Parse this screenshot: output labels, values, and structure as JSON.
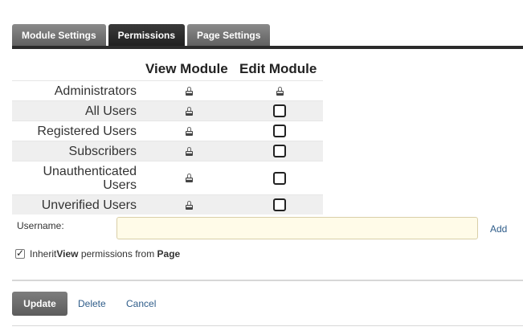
{
  "tabs": [
    {
      "label": "Module Settings",
      "active": false
    },
    {
      "label": "Permissions",
      "active": true
    },
    {
      "label": "Page Settings",
      "active": false
    }
  ],
  "columns": {
    "view": "View Module",
    "edit": "Edit Module"
  },
  "roles": [
    {
      "label": "Administrators",
      "view": "lock-icon",
      "edit": "lock-icon"
    },
    {
      "label": "All Users",
      "view": "lock-icon",
      "edit": "unchecked"
    },
    {
      "label": "Registered Users",
      "view": "lock-icon",
      "edit": "unchecked"
    },
    {
      "label": "Subscribers",
      "view": "lock-icon",
      "edit": "unchecked"
    },
    {
      "label": "Unauthenticated Users",
      "view": "lock-icon",
      "edit": "unchecked"
    },
    {
      "label": "Unverified Users",
      "view": "lock-icon",
      "edit": "unchecked"
    }
  ],
  "username": {
    "label": "Username:",
    "value": "",
    "add_label": "Add"
  },
  "inherit": {
    "checked": true,
    "prefix": "Inherit ",
    "view_word": "View",
    "middle": " permissions from ",
    "page_word": "Page"
  },
  "actions": {
    "update_label": "Update",
    "delete_label": "Delete",
    "cancel_label": "Cancel"
  },
  "colors": {
    "tab_active": "#2b2b2b",
    "tab_inactive": "#6f6f6f",
    "link": "#2f5d8a",
    "input_bg": "#fffbe8",
    "row_alt": "#efefef"
  }
}
